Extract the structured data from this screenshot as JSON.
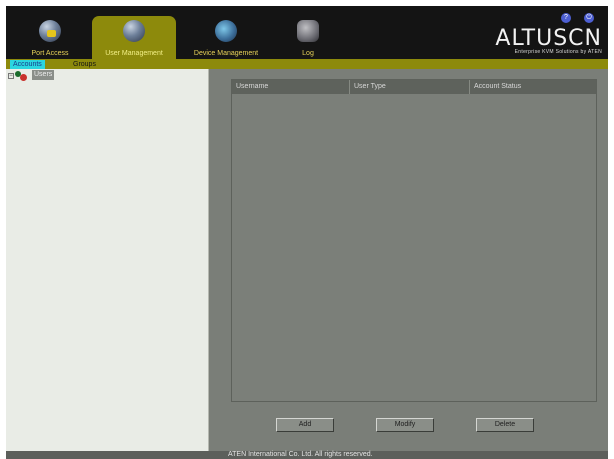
{
  "nav": {
    "tabs": [
      {
        "label": "Port Access",
        "icon": "port-access-icon"
      },
      {
        "label": "User Management",
        "icon": "user-management-icon"
      },
      {
        "label": "Device Management",
        "icon": "device-management-icon"
      },
      {
        "label": "Log",
        "icon": "log-icon"
      }
    ],
    "active_tab": "User Management"
  },
  "header": {
    "brand_name": "ALTUSCN",
    "brand_tagline": "Enterprise KVM Solutions by ATEN",
    "help_icon": "help-icon",
    "logout_icon": "logout-icon"
  },
  "subnav": {
    "tabs": [
      "Accounts",
      "Groups"
    ],
    "active": "Accounts"
  },
  "tree": {
    "expander": "−",
    "root_label": "Users"
  },
  "table": {
    "columns": [
      "Username",
      "User Type",
      "Account Status"
    ],
    "rows": []
  },
  "buttons": {
    "add": "Add",
    "modify": "Modify",
    "delete": "Delete"
  },
  "footer": {
    "copyright": "ATEN International Co. Ltd. All rights reserved."
  },
  "colors": {
    "accent": "#8d8a0c",
    "header_bg": "#141414",
    "panel_bg": "#7a7e78",
    "tree_bg": "#e9ece6",
    "active_subtab": "#2bd6e0"
  }
}
